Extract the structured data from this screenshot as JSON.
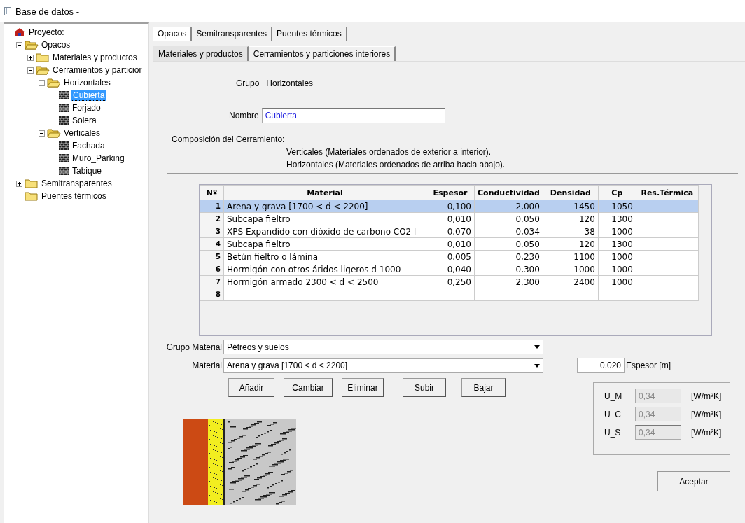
{
  "window": {
    "title": "Base de datos -"
  },
  "tree": [
    {
      "label": "Proyecto:",
      "kind": "project",
      "selected": false,
      "children": [
        {
          "label": "Opacos",
          "kind": "folder",
          "expanded": true,
          "selected": false,
          "children": [
            {
              "label": "Materiales y productos",
              "kind": "folder",
              "expanded": false,
              "selected": false
            },
            {
              "label": "Cerramientos y particior",
              "kind": "folder",
              "expanded": true,
              "selected": false,
              "children": [
                {
                  "label": "Horizontales",
                  "kind": "folder",
                  "expanded": true,
                  "selected": false,
                  "children": [
                    {
                      "label": "Cubierta",
                      "kind": "item",
                      "selected": true
                    },
                    {
                      "label": "Forjado",
                      "kind": "item",
                      "selected": false
                    },
                    {
                      "label": "Solera",
                      "kind": "item",
                      "selected": false
                    }
                  ]
                },
                {
                  "label": "Verticales",
                  "kind": "folder",
                  "expanded": true,
                  "selected": false,
                  "children": [
                    {
                      "label": "Fachada",
                      "kind": "item",
                      "selected": false
                    },
                    {
                      "label": "Muro_Parking",
                      "kind": "item",
                      "selected": false
                    },
                    {
                      "label": "Tabique",
                      "kind": "item",
                      "selected": false
                    }
                  ]
                }
              ]
            }
          ]
        },
        {
          "label": "Semitransparentes",
          "kind": "folder",
          "expanded": false,
          "selected": false
        },
        {
          "label": "Puentes térmicos",
          "kind": "folder",
          "selected": false
        }
      ]
    }
  ],
  "tabs": [
    {
      "label": "Opacos",
      "selected": true
    },
    {
      "label": "Semitransparentes",
      "selected": false
    },
    {
      "label": "Puentes térmicos",
      "selected": false
    }
  ],
  "subtabs": [
    {
      "label": "Materiales y productos",
      "selected": false
    },
    {
      "label": "Cerramientos y particiones interiores",
      "selected": true
    }
  ],
  "grupo": {
    "label": "Grupo",
    "value": "Horizontales"
  },
  "nombre": {
    "label": "Nombre",
    "value": "Cubierta"
  },
  "composicion": {
    "title": "Composición del Cerramiento:",
    "notes": [
      "Verticales (Materiales ordenados de exterior a interior).",
      "Horizontales (Materiales ordenados de arriba hacia abajo)."
    ]
  },
  "table": {
    "columns": [
      "Nº",
      "Material",
      "Espesor",
      "Conductividad",
      "Densidad",
      "Cp",
      "Res.Térmica"
    ],
    "rows": [
      {
        "no": "1",
        "cells": [
          "Arena y grava [1700 < d < 2200]",
          "0,100",
          "2,000",
          "1450",
          "1050"
        ],
        "selected": true
      },
      {
        "no": "2",
        "cells": [
          "Subcapa fieltro",
          "0,010",
          "0,050",
          "120",
          "1300"
        ],
        "selected": false
      },
      {
        "no": "3",
        "cells": [
          "XPS Expandido con dióxido de carbono CO2 [",
          "0,070",
          "0,034",
          "38",
          "1000"
        ],
        "selected": false
      },
      {
        "no": "4",
        "cells": [
          "Subcapa fieltro",
          "0,010",
          "0,050",
          "120",
          "1300"
        ],
        "selected": false
      },
      {
        "no": "5",
        "cells": [
          "Betún fieltro o lámina",
          "0,005",
          "0,230",
          "1100",
          "1000"
        ],
        "selected": false
      },
      {
        "no": "6",
        "cells": [
          "Hormigón con otros áridos ligeros d 1000",
          "0,040",
          "0,300",
          "1000",
          "1000"
        ],
        "selected": false
      },
      {
        "no": "7",
        "cells": [
          "Hormigón armado 2300 < d < 2500",
          "0,250",
          "2,300",
          "2400",
          "1000"
        ],
        "selected": false
      },
      {
        "no": "8",
        "selected": false
      }
    ]
  },
  "grupo_material": {
    "label": "Grupo Material",
    "value": "Pétreos y suelos"
  },
  "material": {
    "label": "Material",
    "value": "Arena y grava [1700 < d < 2200]"
  },
  "espesor": {
    "value": "0,020",
    "label": "Espesor [m]"
  },
  "buttons": [
    "Añadir",
    "Cambiar",
    "Eliminar",
    "Subir",
    "Bajar"
  ],
  "u_values": [
    {
      "label": "U_M",
      "value": "0,34",
      "unit": "[W/m²K]"
    },
    {
      "label": "U_C",
      "value": "0,34",
      "unit": "[W/m²K]"
    },
    {
      "label": "U_S",
      "value": "0,34",
      "unit": "[W/m²K]"
    }
  ],
  "accept": "Aceptar"
}
